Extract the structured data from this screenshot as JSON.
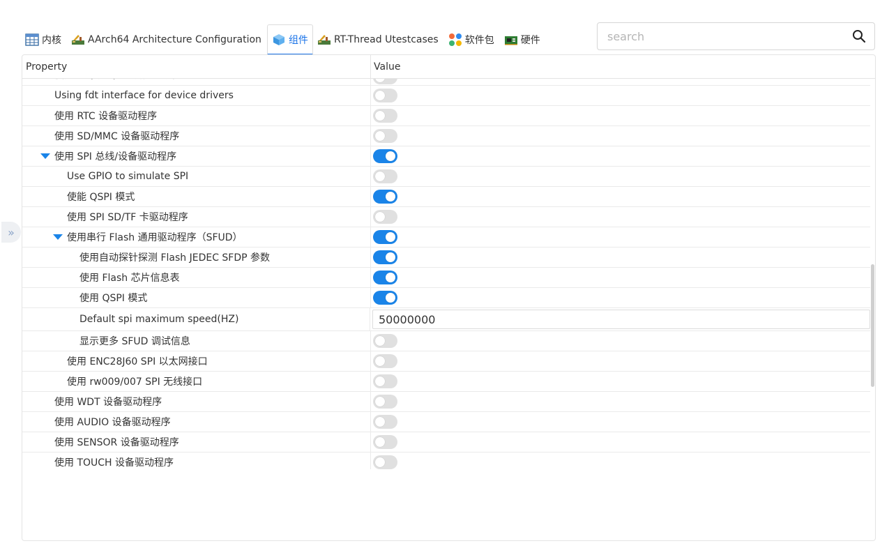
{
  "tabs": [
    {
      "label": "内核",
      "icon": "table-icon",
      "active": false
    },
    {
      "label": "AArch64 Architecture Configuration",
      "icon": "tools-icon",
      "active": false
    },
    {
      "label": "组件",
      "icon": "cube-icon",
      "active": true
    },
    {
      "label": "RT-Thread Utestcases",
      "icon": "tools-icon",
      "active": false
    },
    {
      "label": "软件包",
      "icon": "apps-icon",
      "active": false
    },
    {
      "label": "硬件",
      "icon": "board-icon",
      "active": false
    }
  ],
  "search": {
    "placeholder": "search",
    "value": ""
  },
  "table": {
    "header_property": "Property",
    "header_value": "Value",
    "rows": [
      {
        "label": "使用 ... (可选) ... 设备驱动程序",
        "indent": 0,
        "type": "toggle",
        "on": false,
        "partial": true
      },
      {
        "label": "Using fdt interface for device drivers",
        "indent": 0,
        "type": "toggle",
        "on": false
      },
      {
        "label": "使用 RTC 设备驱动程序",
        "indent": 0,
        "type": "toggle",
        "on": false
      },
      {
        "label": "使用 SD/MMC 设备驱动程序",
        "indent": 0,
        "type": "toggle",
        "on": false
      },
      {
        "label": "使用 SPI 总线/设备驱动程序",
        "indent": 0,
        "type": "toggle",
        "on": true,
        "expandable": true
      },
      {
        "label": "Use GPIO to simulate SPI",
        "indent": 1,
        "type": "toggle",
        "on": false
      },
      {
        "label": "使能 QSPI 模式",
        "indent": 1,
        "type": "toggle",
        "on": true
      },
      {
        "label": "使用 SPI SD/TF 卡驱动程序",
        "indent": 1,
        "type": "toggle",
        "on": false
      },
      {
        "label": "使用串行 Flash 通用驱动程序（SFUD）",
        "indent": 1,
        "type": "toggle",
        "on": true,
        "expandable": true
      },
      {
        "label": "使用自动探针探测 Flash JEDEC SFDP 参数",
        "indent": 2,
        "type": "toggle",
        "on": true
      },
      {
        "label": "使用 Flash 芯片信息表",
        "indent": 2,
        "type": "toggle",
        "on": true
      },
      {
        "label": "使用 QSPI 模式",
        "indent": 2,
        "type": "toggle",
        "on": true
      },
      {
        "label": "Default spi maximum speed(HZ)",
        "indent": 2,
        "type": "input",
        "value": "50000000"
      },
      {
        "label": "显示更多 SFUD 调试信息",
        "indent": 2,
        "type": "toggle",
        "on": false
      },
      {
        "label": "使用 ENC28J60 SPI 以太网接口",
        "indent": 1,
        "type": "toggle",
        "on": false
      },
      {
        "label": "使用 rw009/007 SPI 无线接口",
        "indent": 1,
        "type": "toggle",
        "on": false
      },
      {
        "label": "使用 WDT 设备驱动程序",
        "indent": 0,
        "type": "toggle",
        "on": false
      },
      {
        "label": "使用 AUDIO 设备驱动程序",
        "indent": 0,
        "type": "toggle",
        "on": false
      },
      {
        "label": "使用 SENSOR 设备驱动程序",
        "indent": 0,
        "type": "toggle",
        "on": false
      },
      {
        "label": "使用 TOUCH 设备驱动程序",
        "indent": 0,
        "type": "toggle",
        "on": false
      }
    ]
  },
  "colors": {
    "accent": "#1a84e8",
    "toggle_off": "#e0e0e0",
    "border": "#e4e4e4"
  }
}
